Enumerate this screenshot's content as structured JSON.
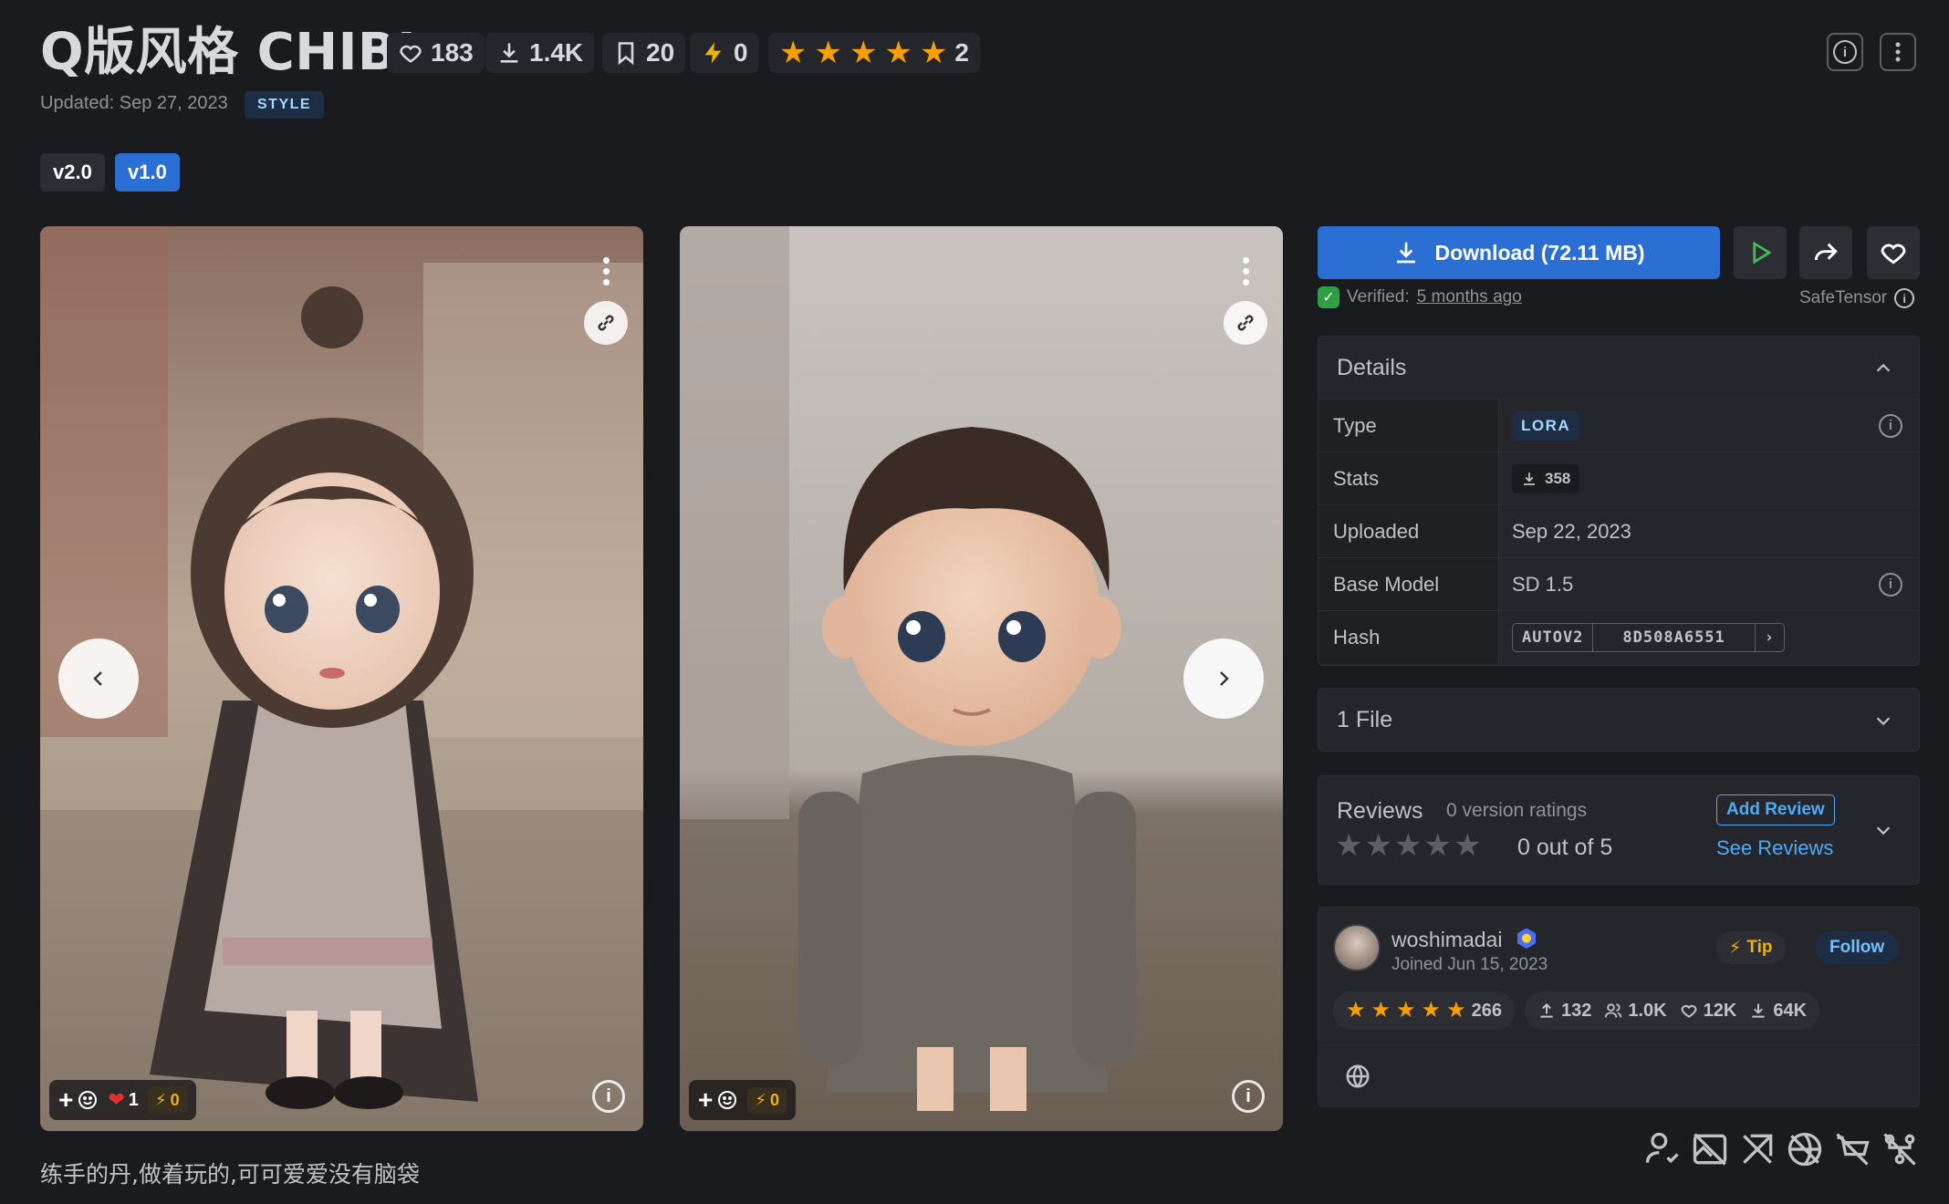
{
  "header": {
    "title": "Q版风格 CHIBI",
    "likes": "183",
    "downloads": "1.4K",
    "bookmarks": "20",
    "buzz": "0",
    "rating_count": "2",
    "updated": "Updated: Sep 27, 2023",
    "category_badge": "STYLE"
  },
  "versions": [
    "v2.0",
    "v1.0"
  ],
  "active_version": "v1.0",
  "images": [
    {
      "reactions": {
        "hearts": "1",
        "buzz": "0"
      }
    },
    {
      "reactions": {
        "buzz": "0"
      }
    }
  ],
  "caption": "练手的丹,做着玩的,可可爱爱没有脑袋",
  "download": {
    "label": "Download (72.11 MB)",
    "verified_label": "Verified:",
    "verified_time": "5 months ago",
    "format": "SafeTensor"
  },
  "details": {
    "heading": "Details",
    "rows": [
      {
        "label": "Type",
        "value": "LORA"
      },
      {
        "label": "Stats",
        "value": "358"
      },
      {
        "label": "Uploaded",
        "value": "Sep 22, 2023"
      },
      {
        "label": "Base Model",
        "value": "SD 1.5"
      },
      {
        "label": "Hash",
        "hash_type": "AUTOV2",
        "value": "8D508A6551"
      }
    ]
  },
  "files": {
    "label": "1 File"
  },
  "reviews": {
    "heading": "Reviews",
    "ratings_text": "0 version ratings",
    "score_text": "0 out of 5",
    "add_label": "Add Review",
    "see_label": "See Reviews"
  },
  "creator": {
    "name": "woshimadai",
    "joined": "Joined Jun 15, 2023",
    "tip_label": "Tip",
    "follow_label": "Follow",
    "rating_count": "266",
    "uploads": "132",
    "followers": "1.0K",
    "likes": "12K",
    "downloads": "64K"
  },
  "colors": {
    "accent": "#2b6fd4",
    "star": "#f59f00",
    "background": "#1a1b1e",
    "panel": "#25262b"
  }
}
